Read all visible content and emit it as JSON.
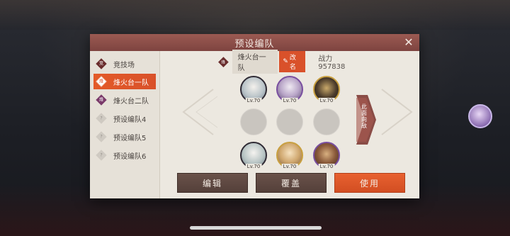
{
  "modal": {
    "title": "预设编队",
    "close_icon": "close-icon"
  },
  "sidebar": {
    "items": [
      {
        "label": "竞技场",
        "icon_text": "竞",
        "icon": "arena-badge-icon",
        "active": false
      },
      {
        "label": "烽火台一队",
        "icon_text": "烽",
        "icon": "beacon-badge-icon",
        "active": true
      },
      {
        "label": "烽火台二队",
        "icon_text": "烽",
        "icon": "beacon-badge-icon",
        "active": false
      },
      {
        "label": "预设编队4",
        "icon_text": "?",
        "icon": "question-badge-icon",
        "active": false
      },
      {
        "label": "预设编队5",
        "icon_text": "?",
        "icon": "question-badge-icon",
        "active": false
      },
      {
        "label": "预设编队6",
        "icon_text": "?",
        "icon": "question-badge-icon",
        "active": false
      }
    ]
  },
  "team": {
    "badge_text": "烽",
    "name": "烽火台一队",
    "rename_label": "改名",
    "power_label": "战力 957838"
  },
  "formation": {
    "front_row": [
      {
        "level": "Lv.70",
        "portrait": "silver-haired-hero"
      },
      {
        "level": "Lv.70",
        "portrait": "purple-haired-hero"
      },
      {
        "level": "Lv.70",
        "portrait": "dark-armored-hero"
      }
    ],
    "middle_row": [
      {
        "level": ""
      },
      {
        "level": ""
      },
      {
        "level": ""
      }
    ],
    "back_row": [
      {
        "level": "Lv.70",
        "portrait": "white-haired-hero"
      },
      {
        "level": "Lv.70",
        "portrait": "blonde-hero"
      },
      {
        "level": "Lv.70",
        "portrait": "bronze-armored-hero"
      }
    ],
    "direction_label": "此面向敌"
  },
  "buttons": {
    "edit": "编辑",
    "overwrite": "覆盖",
    "use": "使用"
  },
  "colors": {
    "accent": "#d9512a",
    "header": "#8a4c46",
    "panel": "#ece8e0",
    "dark_button": "#5e4841"
  }
}
